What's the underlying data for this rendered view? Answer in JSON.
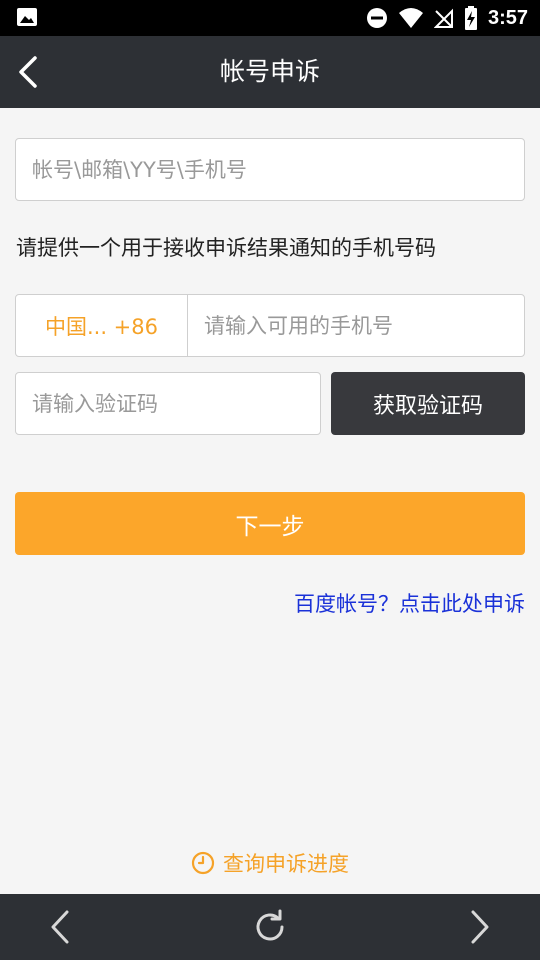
{
  "status_bar": {
    "time": "3:57",
    "icons": [
      "image-icon",
      "do-not-disturb-icon",
      "wifi-icon",
      "no-signal-icon",
      "battery-charging-icon"
    ]
  },
  "title_bar": {
    "title": "帐号申诉",
    "back_icon": "back-chevron-icon"
  },
  "form": {
    "account_placeholder": "帐号\\邮箱\\YY号\\手机号",
    "hint": "请提供一个用于接收申诉结果通知的手机号码",
    "country_code": "中国... +86",
    "phone_placeholder": "请输入可用的手机号",
    "code_placeholder": "请输入验证码",
    "get_code_label": "获取验证码",
    "next_label": "下一步",
    "baidu_link": "百度帐号？点击此处申诉"
  },
  "progress": {
    "label": "查询申诉进度",
    "icon": "clock-icon"
  },
  "colors": {
    "accent": "#fca62a",
    "link": "#1a31d8",
    "dark": "#2d3035",
    "button_dark": "#38393d"
  },
  "nav_bar": {
    "icons": [
      "nav-back-icon",
      "refresh-icon",
      "nav-forward-icon"
    ]
  }
}
